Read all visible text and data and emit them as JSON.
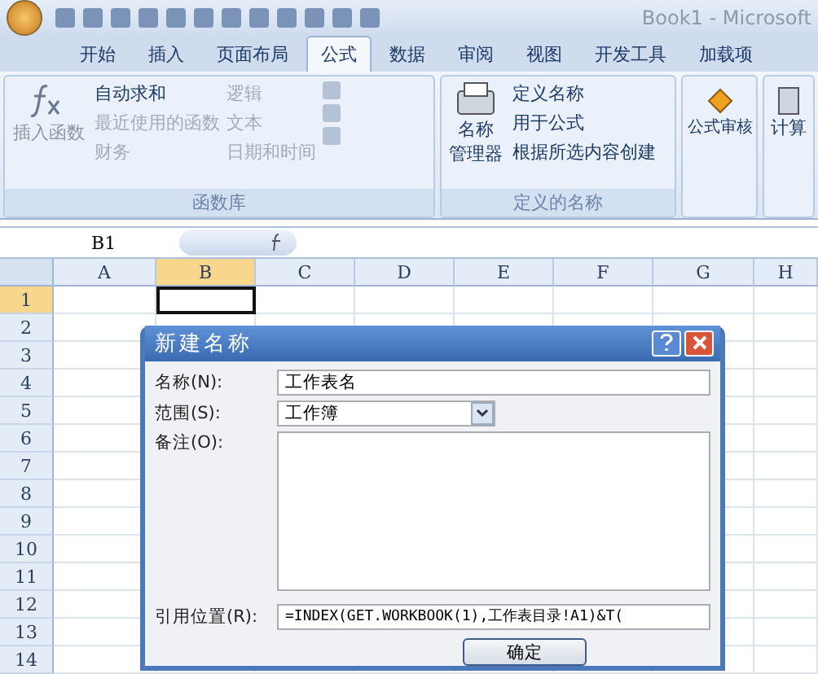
{
  "title_bar": {
    "title": "Book1 - Microsoft"
  },
  "tabs": [
    {
      "label": "开始",
      "selected": false
    },
    {
      "label": "插入",
      "selected": false
    },
    {
      "label": "页面布局",
      "selected": false
    },
    {
      "label": "公式",
      "selected": true
    },
    {
      "label": "数据",
      "selected": false
    },
    {
      "label": "审阅",
      "selected": false
    },
    {
      "label": "视图",
      "selected": false
    },
    {
      "label": "开发工具",
      "selected": false
    },
    {
      "label": "加载项",
      "selected": false
    }
  ],
  "ribbon": {
    "function_library": {
      "label": "函数库",
      "insert_function": "插入函数",
      "column_1": [
        {
          "label": "自动求和",
          "disabled": false
        },
        {
          "label": "最近使用的函数",
          "disabled": true
        },
        {
          "label": "财务",
          "disabled": true
        }
      ],
      "column_2": [
        {
          "label": "逻辑",
          "disabled": true
        },
        {
          "label": "文本",
          "disabled": true
        },
        {
          "label": "日期和时间",
          "disabled": true
        }
      ]
    },
    "defined_names": {
      "label": "定义的名称",
      "name_manager": [
        "名称",
        "管理器"
      ],
      "items": [
        "定义名称",
        "用于公式",
        "根据所选内容创建"
      ]
    },
    "formula_auditing": "公式审核",
    "calculation": "计算"
  },
  "formula_bar": {
    "name_box": "B1"
  },
  "sheet": {
    "columns": [
      {
        "label": "A",
        "selected": false
      },
      {
        "label": "B",
        "selected": true
      },
      {
        "label": "C",
        "selected": false
      },
      {
        "label": "D",
        "selected": false
      },
      {
        "label": "E",
        "selected": false
      },
      {
        "label": "F",
        "selected": false
      },
      {
        "label": "G",
        "selected": false
      },
      {
        "label": "H",
        "selected": false
      }
    ],
    "rows": [
      {
        "label": "1",
        "selected": true
      },
      {
        "label": "2",
        "selected": false
      },
      {
        "label": "3",
        "selected": false
      },
      {
        "label": "4",
        "selected": false
      },
      {
        "label": "5",
        "selected": false
      },
      {
        "label": "6",
        "selected": false
      },
      {
        "label": "7",
        "selected": false
      },
      {
        "label": "8",
        "selected": false
      },
      {
        "label": "9",
        "selected": false
      },
      {
        "label": "10",
        "selected": false
      },
      {
        "label": "11",
        "selected": false
      },
      {
        "label": "12",
        "selected": false
      },
      {
        "label": "13",
        "selected": false
      },
      {
        "label": "14",
        "selected": false
      }
    ]
  },
  "dialog": {
    "title": "新建名称",
    "name_label": "名称(N):",
    "name_value": "工作表名",
    "scope_label": "范围(S):",
    "scope_value": "工作簿",
    "comment_label": "备注(O):",
    "refers_to_label": "引用位置(R):",
    "refers_to_value": "=INDEX(GET.WORKBOOK(1),工作表目录!A1)&T(",
    "ok_button": "确定"
  }
}
